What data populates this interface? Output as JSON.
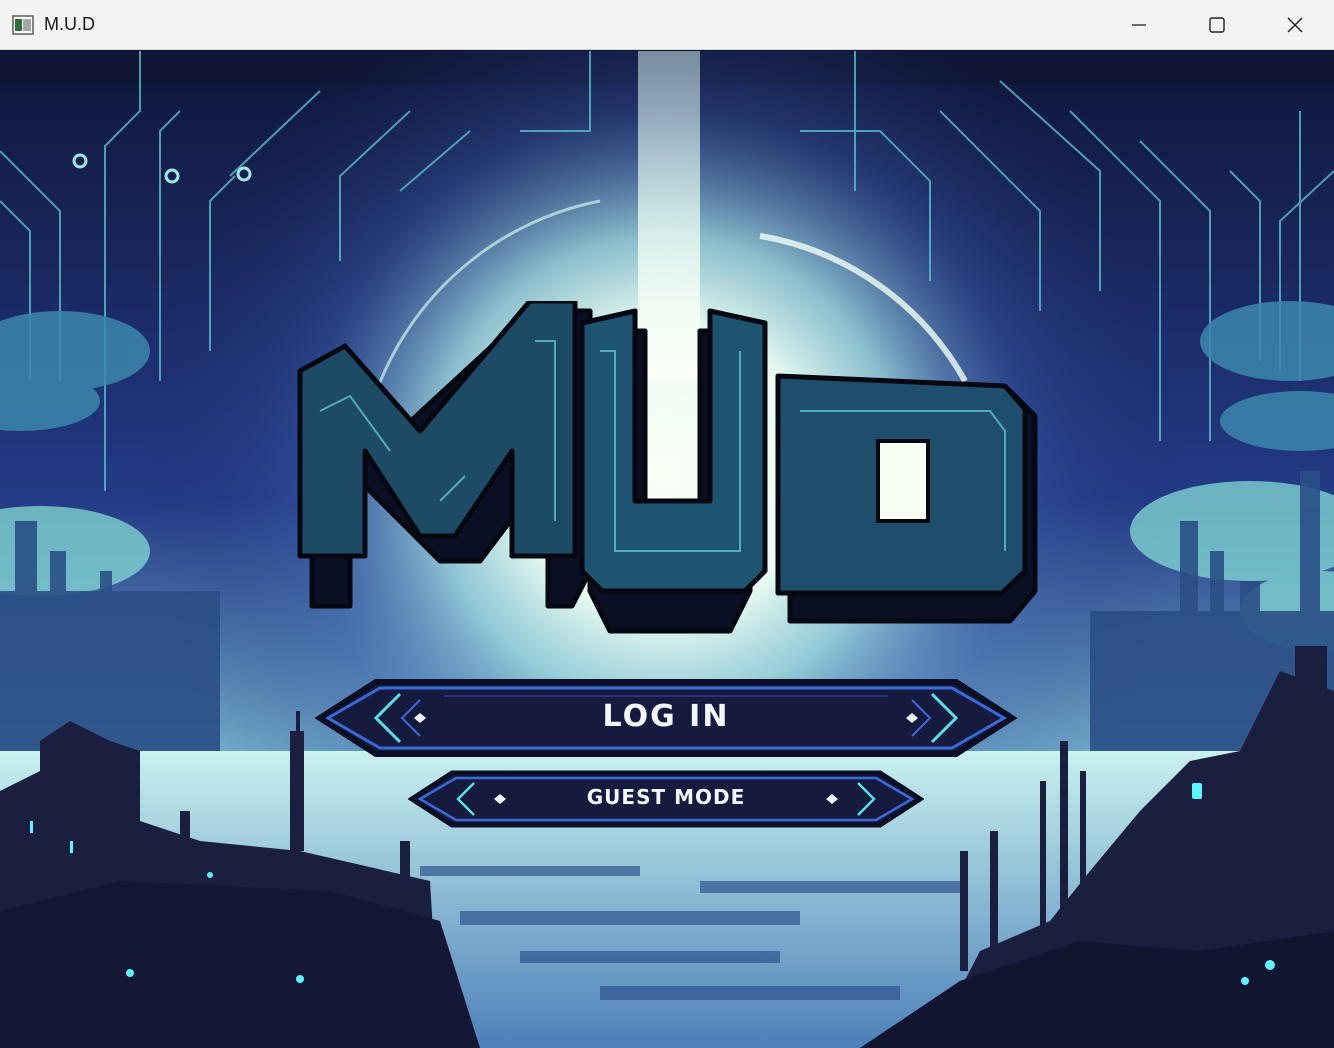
{
  "window": {
    "title": "M.U.D",
    "icon": "app-window-icon",
    "controls": [
      "minimize-icon",
      "maximize-icon",
      "close-icon"
    ]
  },
  "game": {
    "logo_text": "MUD",
    "login_label": "LOG IN",
    "guest_label": "GUEST MODE"
  },
  "colors": {
    "sky_dark": "#151c4a",
    "glow": "#eafbf4",
    "accent_cyan": "#58e0e8",
    "button_fill": "#151a3e",
    "button_border": "#3a6ad8"
  }
}
